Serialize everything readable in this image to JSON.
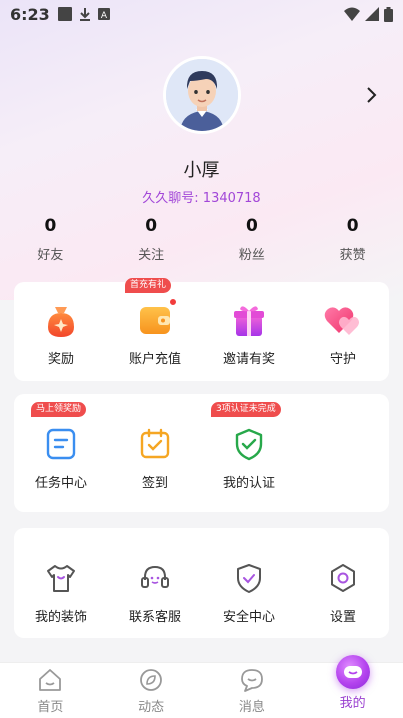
{
  "status_bar": {
    "time": "6:23"
  },
  "profile": {
    "name": "小厚",
    "id_text": "久久聊号: 1340718",
    "stats": [
      {
        "value": "0",
        "label": "好友"
      },
      {
        "value": "0",
        "label": "关注"
      },
      {
        "value": "0",
        "label": "粉丝"
      },
      {
        "value": "0",
        "label": "获赞"
      }
    ]
  },
  "card1": {
    "items": [
      {
        "label": "奖励",
        "icon": "reward-bag-icon"
      },
      {
        "label": "账户充值",
        "icon": "wallet-icon",
        "badge": "首充有礼"
      },
      {
        "label": "邀请有奖",
        "icon": "gift-icon"
      },
      {
        "label": "守护",
        "icon": "hearts-icon"
      }
    ]
  },
  "card2": {
    "items": [
      {
        "label": "任务中心",
        "icon": "task-icon",
        "badge": "马上领奖励"
      },
      {
        "label": "签到",
        "icon": "calendar-icon"
      },
      {
        "label": "我的认证",
        "icon": "shield-check-icon",
        "badge": "3项认证未完成"
      }
    ]
  },
  "card3": {
    "items": [
      {
        "label": "我的装饰",
        "icon": "shirt-icon"
      },
      {
        "label": "联系客服",
        "icon": "headset-icon"
      },
      {
        "label": "安全中心",
        "icon": "shield-icon"
      },
      {
        "label": "设置",
        "icon": "settings-icon"
      }
    ]
  },
  "bottom_nav": {
    "items": [
      {
        "label": "首页",
        "icon": "home-icon"
      },
      {
        "label": "动态",
        "icon": "leaf-icon"
      },
      {
        "label": "消息",
        "icon": "message-icon"
      },
      {
        "label": "我的",
        "icon": "me-icon",
        "active": true
      }
    ]
  },
  "colors": {
    "accent": "#9a3fd0",
    "badge": "#ef4d4d",
    "id_text": "#a247d8"
  }
}
